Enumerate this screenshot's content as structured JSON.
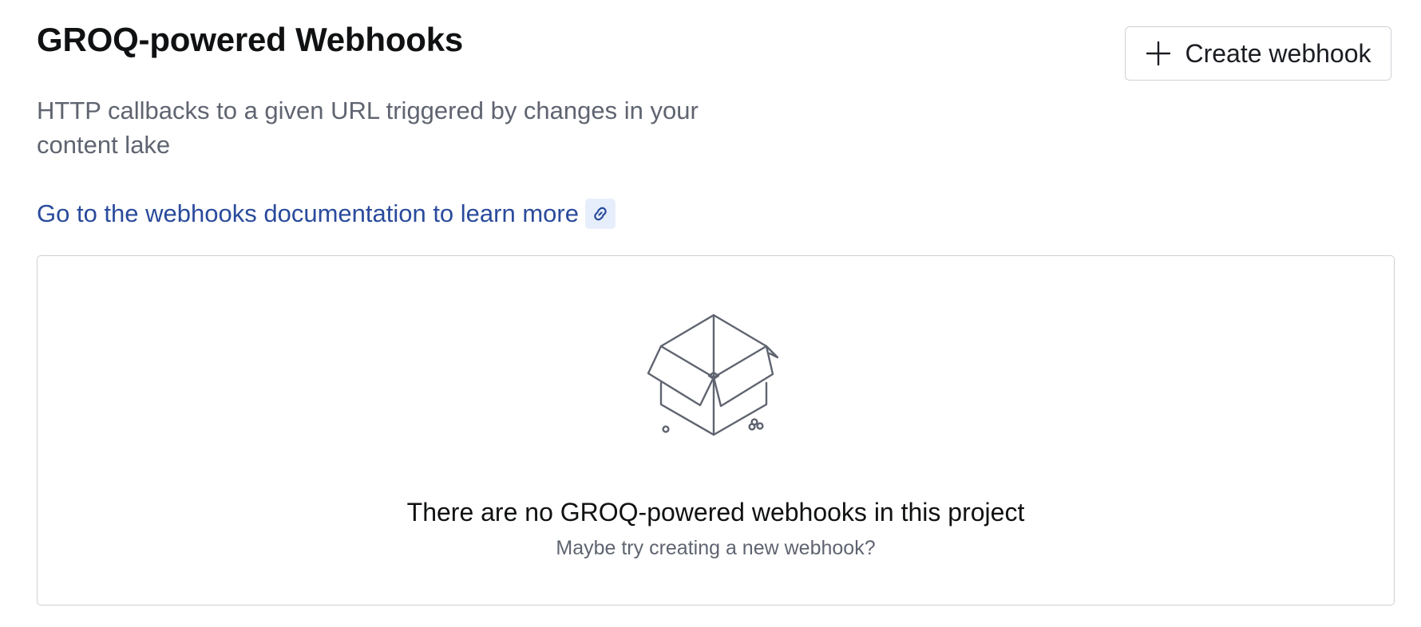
{
  "header": {
    "title": "GROQ-powered Webhooks",
    "description": "HTTP callbacks to a given URL triggered by changes in your content lake",
    "create_button": {
      "label": "Create webhook",
      "icon": "plus-icon"
    }
  },
  "documentation_link": {
    "label": "Go to the webhooks documentation to learn more",
    "icon": "link-icon"
  },
  "empty_state": {
    "illustration": "open-box-icon",
    "title": "There are no GROQ-powered webhooks in this project",
    "hint": "Maybe try creating a new webhook?"
  },
  "colors": {
    "link": "#2a4b9c",
    "link_icon_background": "#e7eefb",
    "muted_text": "#5f6470",
    "border": "#cfd1d6",
    "illustration_stroke": "#5f6470"
  }
}
